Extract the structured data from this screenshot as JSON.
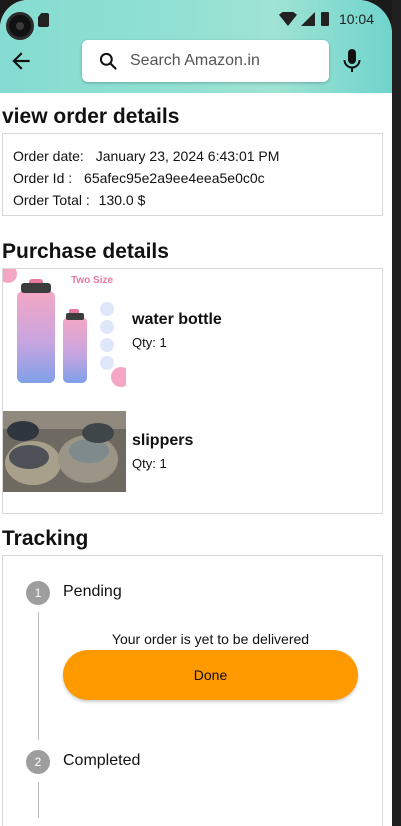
{
  "status_bar": {
    "time": "10:04"
  },
  "search": {
    "placeholder": "Search Amazon.in"
  },
  "order_details": {
    "title": "view order details",
    "date_label": "Order date:",
    "date_value": "January 23, 2024 6:43:01 PM",
    "id_label": "Order Id :",
    "id_value": "65afec95e2a9ee4eea5e0c0c",
    "total_label": "Order Total :",
    "total_value": "130.0 $"
  },
  "purchase": {
    "title": "Purchase details",
    "items": [
      {
        "name": "water bottle",
        "qty": "Qty: 1",
        "image_text": "Two Size"
      },
      {
        "name": "slippers",
        "qty": "Qty: 1"
      }
    ]
  },
  "tracking": {
    "title": "Tracking",
    "steps": [
      {
        "number": "1",
        "label": "Pending"
      },
      {
        "number": "2",
        "label": "Completed"
      }
    ],
    "message": "Your order is yet to be delivered",
    "done_label": "Done"
  },
  "colors": {
    "header_teal": "#8fe0d3",
    "accent_orange": "#ff9900",
    "step_grey": "#9e9e9e"
  }
}
